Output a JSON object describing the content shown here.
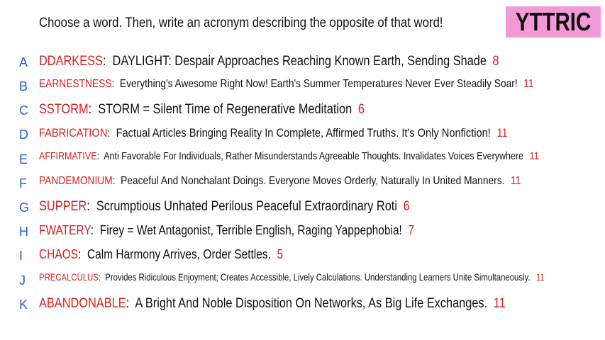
{
  "prompt": "Choose a word. Then, write an acronym describing the opposite of that word!",
  "logo": "YTTRIC",
  "colors": {
    "letter": "#1f5fd6",
    "word": "#d42020",
    "number": "#d42020",
    "logo_bg": "#f29ad8"
  },
  "rows": [
    {
      "letter": "A",
      "word": "DDARKESS",
      "text": "DAYLIGHT: Despair Approaches Reaching Known Earth, Sending Shade",
      "count": "8"
    },
    {
      "letter": "B",
      "word": "EARNESTNESS",
      "text": "Everything's Awesome Right Now! Earth's Summer Temperatures Never Ever Steadily Soar!",
      "count": "11"
    },
    {
      "letter": "C",
      "word": "SSTORM",
      "text": "STORM = Silent Time of Regenerative Meditation",
      "count": "6"
    },
    {
      "letter": "D",
      "word": "FABRICATION",
      "text": "Factual Articles Bringing Reality In Complete, Affirmed Truths. It's Only Nonfiction!",
      "count": "11"
    },
    {
      "letter": "E",
      "word": "AFFIRMATIVE",
      "text": "Anti Favorable For Individuals, Rather Misunderstands Agreeable Thoughts. Invalidates Voices Everywhere",
      "count": "11"
    },
    {
      "letter": "F",
      "word": "PANDEMONIUM",
      "text": "Peaceful And Nonchalant Doings. Everyone Moves Orderly, Naturally In United Manners.",
      "count": "11"
    },
    {
      "letter": "G",
      "word": "SUPPER",
      "text": "Scrumptious Unhated Perilous Peaceful Extraordinary Roti",
      "count": "6"
    },
    {
      "letter": "H",
      "word": "FWATERY",
      "text": "Firey = Wet Antagonist, Terrible English, Raging Yappephobia!",
      "count": "7"
    },
    {
      "letter": "I",
      "word": "CHAOS",
      "text": "Calm Harmony Arrives, Order Settles.",
      "count": "5"
    },
    {
      "letter": "J",
      "word": "PRECALCULUS",
      "text": "Provides Ridiculous Enjoyment; Creates Accessible, Lively Calculations. Understanding Learners Unite Simultaneously.",
      "count": "11"
    },
    {
      "letter": "K",
      "word": "ABANDONABLE",
      "text": "A Bright And Noble Disposition On Networks, As Big Life Exchanges.",
      "count": "11"
    }
  ]
}
